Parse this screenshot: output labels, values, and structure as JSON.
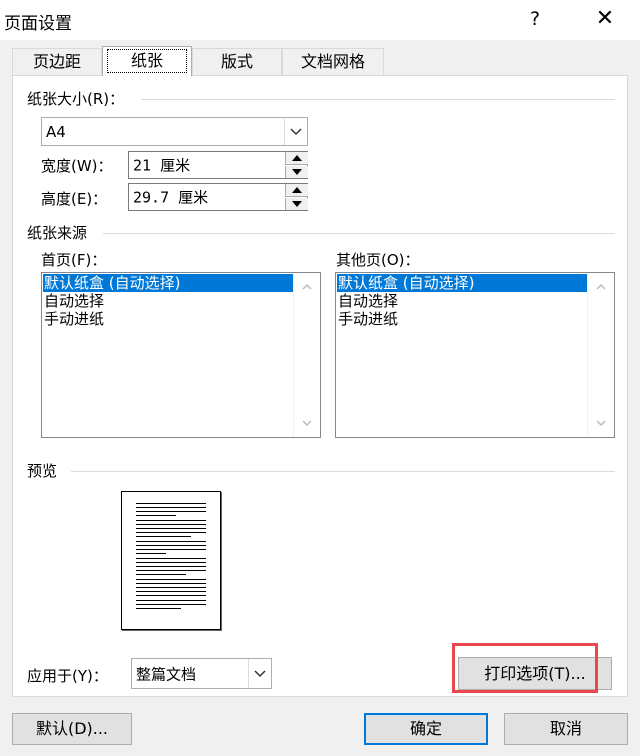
{
  "dialog": {
    "title": "页面设置",
    "help": "?",
    "close": "✕"
  },
  "tabs": [
    "页边距",
    "纸张",
    "版式",
    "文档网格"
  ],
  "paper_size": {
    "group_label": "纸张大小(R)：",
    "combo_value": "A4",
    "width_label": "宽度(W)：",
    "width_value": "21 厘米",
    "height_label": "高度(E)：",
    "height_value": "29.7 厘米"
  },
  "paper_source": {
    "group_label": "纸张来源",
    "first_page_label": "首页(F)：",
    "other_pages_label": "其他页(O)：",
    "first_page_items": [
      "默认纸盒 (自动选择)",
      "自动选择",
      "手动进纸"
    ],
    "other_pages_items": [
      "默认纸盒 (自动选择)",
      "自动选择",
      "手动进纸"
    ]
  },
  "preview": {
    "group_label": "预览"
  },
  "apply": {
    "label": "应用于(Y)：",
    "value": "整篇文档"
  },
  "buttons": {
    "print_options": "打印选项(T)...",
    "default": "默认(D)...",
    "ok": "确定",
    "cancel": "取消"
  },
  "colors": {
    "accent": "#0078d7",
    "highlight": "#e8474e"
  }
}
